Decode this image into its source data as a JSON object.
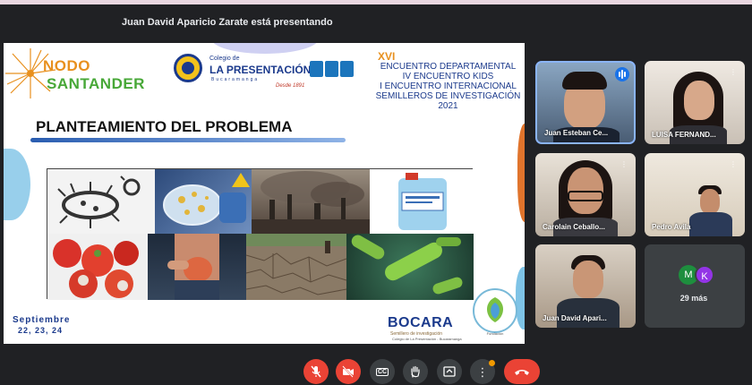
{
  "meeting": {
    "presenter_label": "Juan David Aparicio Zarate está presentando"
  },
  "slide": {
    "nodo_line1": "NODO",
    "nodo_line2": "SANTANDER",
    "colegio_small": "Colegio de",
    "colegio_name": "LA PRESENTACIÓN",
    "colegio_city": "Bucaramanga",
    "colegio_since": "Desde 1891",
    "encuentro": {
      "roman": "XVI",
      "line1": "ENCUENTRO DEPARTAMENTAL",
      "line2": "IV ENCUENTRO KIDS",
      "line3": "I ENCUENTRO INTERNACIONAL",
      "line4": "SEMILLEROS DE INVESTIGACIÓN 2021"
    },
    "title": "PLANTEAMIENTO DEL PROBLEMA",
    "date_month": "Septiembre",
    "date_days": "22, 23, 24",
    "bocara": "BOCARA",
    "bocara_sub": "Semillero de investigación",
    "bocara_sub2": "Colegio de La Presentación - Bucaramanga",
    "fundacion": "Fundación"
  },
  "participants": [
    {
      "name": "Juan Esteban Ce...",
      "speaking": true
    },
    {
      "name": "LUISA FERNAND...",
      "speaking": false
    },
    {
      "name": "Carolain Ceballo...",
      "speaking": false
    },
    {
      "name": "Pedro Avila",
      "speaking": false
    },
    {
      "name": "Juan David Apari...",
      "speaking": false
    }
  ],
  "others": {
    "avatar_m": "M",
    "avatar_k": "K",
    "count_label": "29 más"
  },
  "colors": {
    "meet_bg": "#202124",
    "tile_bg": "#3c4043",
    "red_control": "#ea4335",
    "active_border": "#8ab4f8",
    "speaking_blue": "#1a73e8"
  },
  "controls": {
    "items": [
      "mic-off-icon",
      "camera-off-icon",
      "captions-icon",
      "raise-hand-icon",
      "present-icon",
      "more-options-icon",
      "hang-up-icon"
    ],
    "captions_label": "CC"
  }
}
